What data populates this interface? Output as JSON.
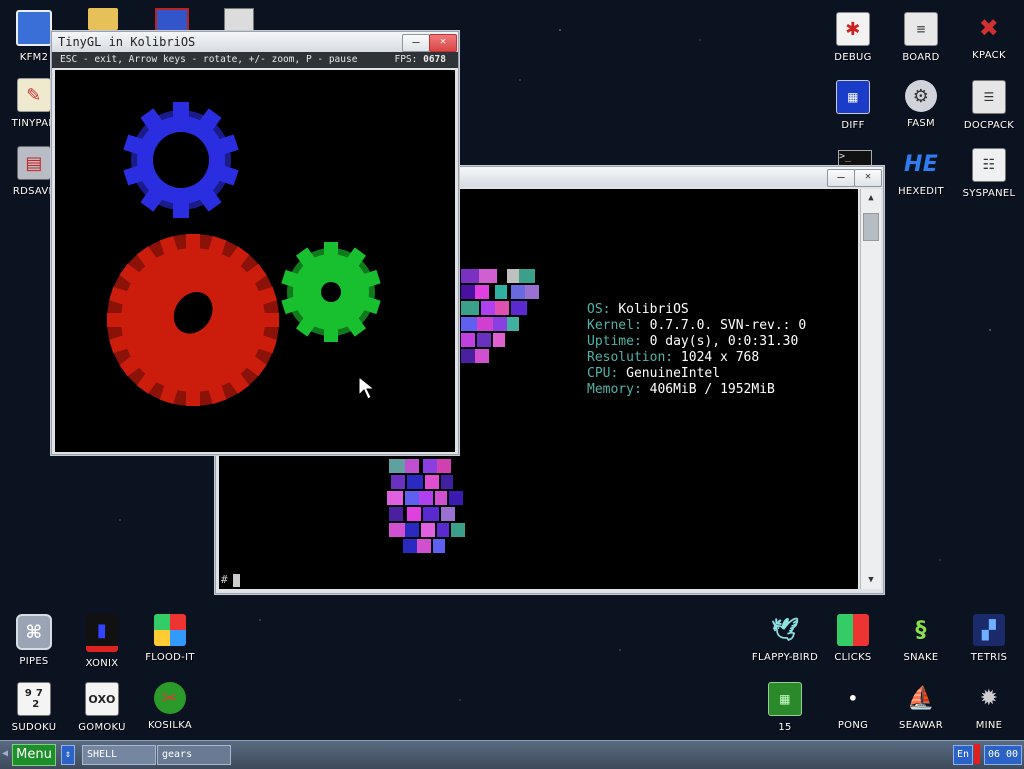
{
  "desktop": {
    "left_icons": [
      {
        "label": "KFM2",
        "icon": "floppy-icon",
        "color": "#3a6fd8"
      },
      {
        "label": "TINYPAD",
        "icon": "notepad-icon",
        "color": "#e8e4d0"
      },
      {
        "label": "RDSAVE",
        "icon": "ramdisk-icon",
        "color": "#c0c0c0"
      }
    ],
    "top_partial_icons": [
      {
        "icon": "folder-icon",
        "color": "#e6c15a"
      },
      {
        "icon": "monitor-icon",
        "color": "#3355cc"
      },
      {
        "icon": "calculator-icon",
        "color": "#dcdcdc"
      }
    ],
    "right_icons": [
      {
        "label": "DEBUG",
        "icon": "bug-icon"
      },
      {
        "label": "BOARD",
        "icon": "board-icon"
      },
      {
        "label": "KPACK",
        "icon": "wrench-icon"
      },
      {
        "label": "DIFF",
        "icon": "diff-icon"
      },
      {
        "label": "FASM",
        "icon": "fasm-icon"
      },
      {
        "label": "DOCPACK",
        "icon": "cabinet-icon"
      },
      {
        "label": "HEXEDIT",
        "icon": "hex-icon",
        "glyph": "HE"
      },
      {
        "label": "SYSPANEL",
        "icon": "sliders-icon"
      }
    ],
    "bottom_left_icons": [
      {
        "label": "PIPES",
        "icon": "pipes-icon"
      },
      {
        "label": "XONIX",
        "icon": "xonix-icon"
      },
      {
        "label": "FLOOD-IT",
        "icon": "flood-icon"
      },
      {
        "label": "SUDOKU",
        "icon": "sudoku-icon",
        "glyph": "9 7\n 2"
      },
      {
        "label": "GOMOKU",
        "icon": "gomoku-icon",
        "glyph": "OXO"
      },
      {
        "label": "KOSILKA",
        "icon": "mower-icon"
      }
    ],
    "bottom_right_icons": [
      {
        "label": "FLAPPY-BIRD",
        "icon": "bird-icon"
      },
      {
        "label": "CLICKS",
        "icon": "clicks-icon"
      },
      {
        "label": "SNAKE",
        "icon": "snake-icon"
      },
      {
        "label": "TETRIS",
        "icon": "tetris-icon"
      },
      {
        "label": "15",
        "icon": "fifteen-icon"
      },
      {
        "label": "PONG",
        "icon": "pong-icon"
      },
      {
        "label": "SEAWAR",
        "icon": "ship-icon"
      },
      {
        "label": "MINE",
        "icon": "mine-icon"
      }
    ]
  },
  "gears_window": {
    "title": "TinyGL in KolibriOS",
    "help": "ESC - exit, Arrow keys - rotate, +/- zoom, P - pause",
    "fps_label": "FPS:",
    "fps_value": "0678",
    "minimize": "–",
    "close": "✕"
  },
  "shell_window": {
    "minimize": "–",
    "close": "✕",
    "info": [
      {
        "key": "OS:",
        "value": "KolibriOS"
      },
      {
        "key": "Kernel:",
        "value": "0.7.7.0. SVN-rev.: 0"
      },
      {
        "key": "Uptime:",
        "value": "0 day(s), 0:0:31.30"
      },
      {
        "key": "Resolution:",
        "value": "1024 x 768"
      },
      {
        "key": "CPU:",
        "value": "GenuineIntel"
      },
      {
        "key": "Memory:",
        "value": "406MiB / 1952MiB"
      }
    ],
    "prompt": "#",
    "scroll_up": "▲",
    "scroll_down": "▼"
  },
  "taskbar": {
    "menu": "Menu",
    "switch": "⇕",
    "tasks": [
      "SHELL",
      "gears"
    ],
    "lang": "En",
    "clock": "06 00"
  },
  "colors": {
    "gear_blue": "#2a2ee0",
    "gear_red": "#cc1c0c",
    "gear_green": "#18c030",
    "info_key": "#4fb3a8",
    "info_value": "#ffffff",
    "menu_green": "#1d8f2a"
  }
}
